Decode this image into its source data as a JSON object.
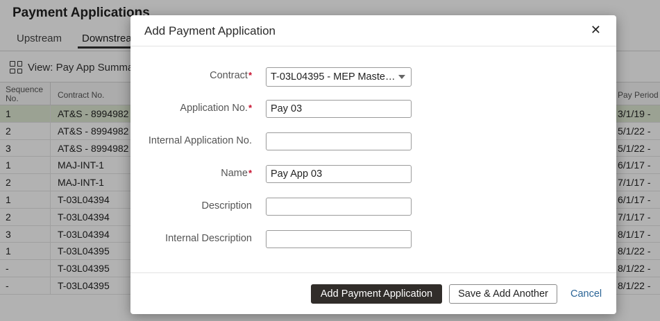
{
  "background": {
    "title": "Payment Applications",
    "tabs": [
      "Upstream",
      "Downstream"
    ],
    "view_label": "View: Pay App Summary",
    "table": {
      "headers": {
        "sequence": "Sequence No.",
        "contract": "Contract No.",
        "pay_period": "Pay Period"
      },
      "rows": [
        {
          "seq": "1",
          "contract": "AT&S - 8994982",
          "period": "3/1/19 -"
        },
        {
          "seq": "2",
          "contract": "AT&S - 8994982",
          "period": "5/1/22 -"
        },
        {
          "seq": "3",
          "contract": "AT&S - 8994982",
          "period": "5/1/22 -"
        },
        {
          "seq": "1",
          "contract": "MAJ-INT-1",
          "period": "6/1/17 -"
        },
        {
          "seq": "2",
          "contract": "MAJ-INT-1",
          "period": "7/1/17 -"
        },
        {
          "seq": "1",
          "contract": "T-03L04394",
          "period": "6/1/17 -"
        },
        {
          "seq": "2",
          "contract": "T-03L04394",
          "period": "7/1/17 -"
        },
        {
          "seq": "3",
          "contract": "T-03L04394",
          "period": "8/1/17 -"
        },
        {
          "seq": "1",
          "contract": "T-03L04395",
          "period": "8/1/22 -"
        },
        {
          "seq": "-",
          "contract": "T-03L04395",
          "period": "8/1/22 -"
        },
        {
          "seq": "-",
          "contract": "T-03L04395",
          "period": "8/1/22 -"
        }
      ]
    },
    "selected_row_color": "#dfe9d3"
  },
  "dialog": {
    "title": "Add Payment Application",
    "close_icon": "close-icon",
    "fields": {
      "contract": {
        "label": "Contract",
        "value": "T-03L04395 - MEP Maste…",
        "required": true
      },
      "application_no": {
        "label": "Application No.",
        "value": "Pay 03",
        "required": true
      },
      "internal_application_no": {
        "label": "Internal Application No.",
        "value": "",
        "required": false
      },
      "name": {
        "label": "Name",
        "value": "Pay App 03",
        "required": true
      },
      "description": {
        "label": "Description",
        "value": "",
        "required": false
      },
      "internal_description": {
        "label": "Internal Description",
        "value": "",
        "required": false
      }
    },
    "required_marker": "*",
    "buttons": {
      "primary": "Add Payment Application",
      "secondary": "Save & Add Another",
      "cancel": "Cancel"
    },
    "colors": {
      "primary_button": "#312d2a",
      "required": "#c8102e",
      "link": "#2a6496"
    }
  }
}
